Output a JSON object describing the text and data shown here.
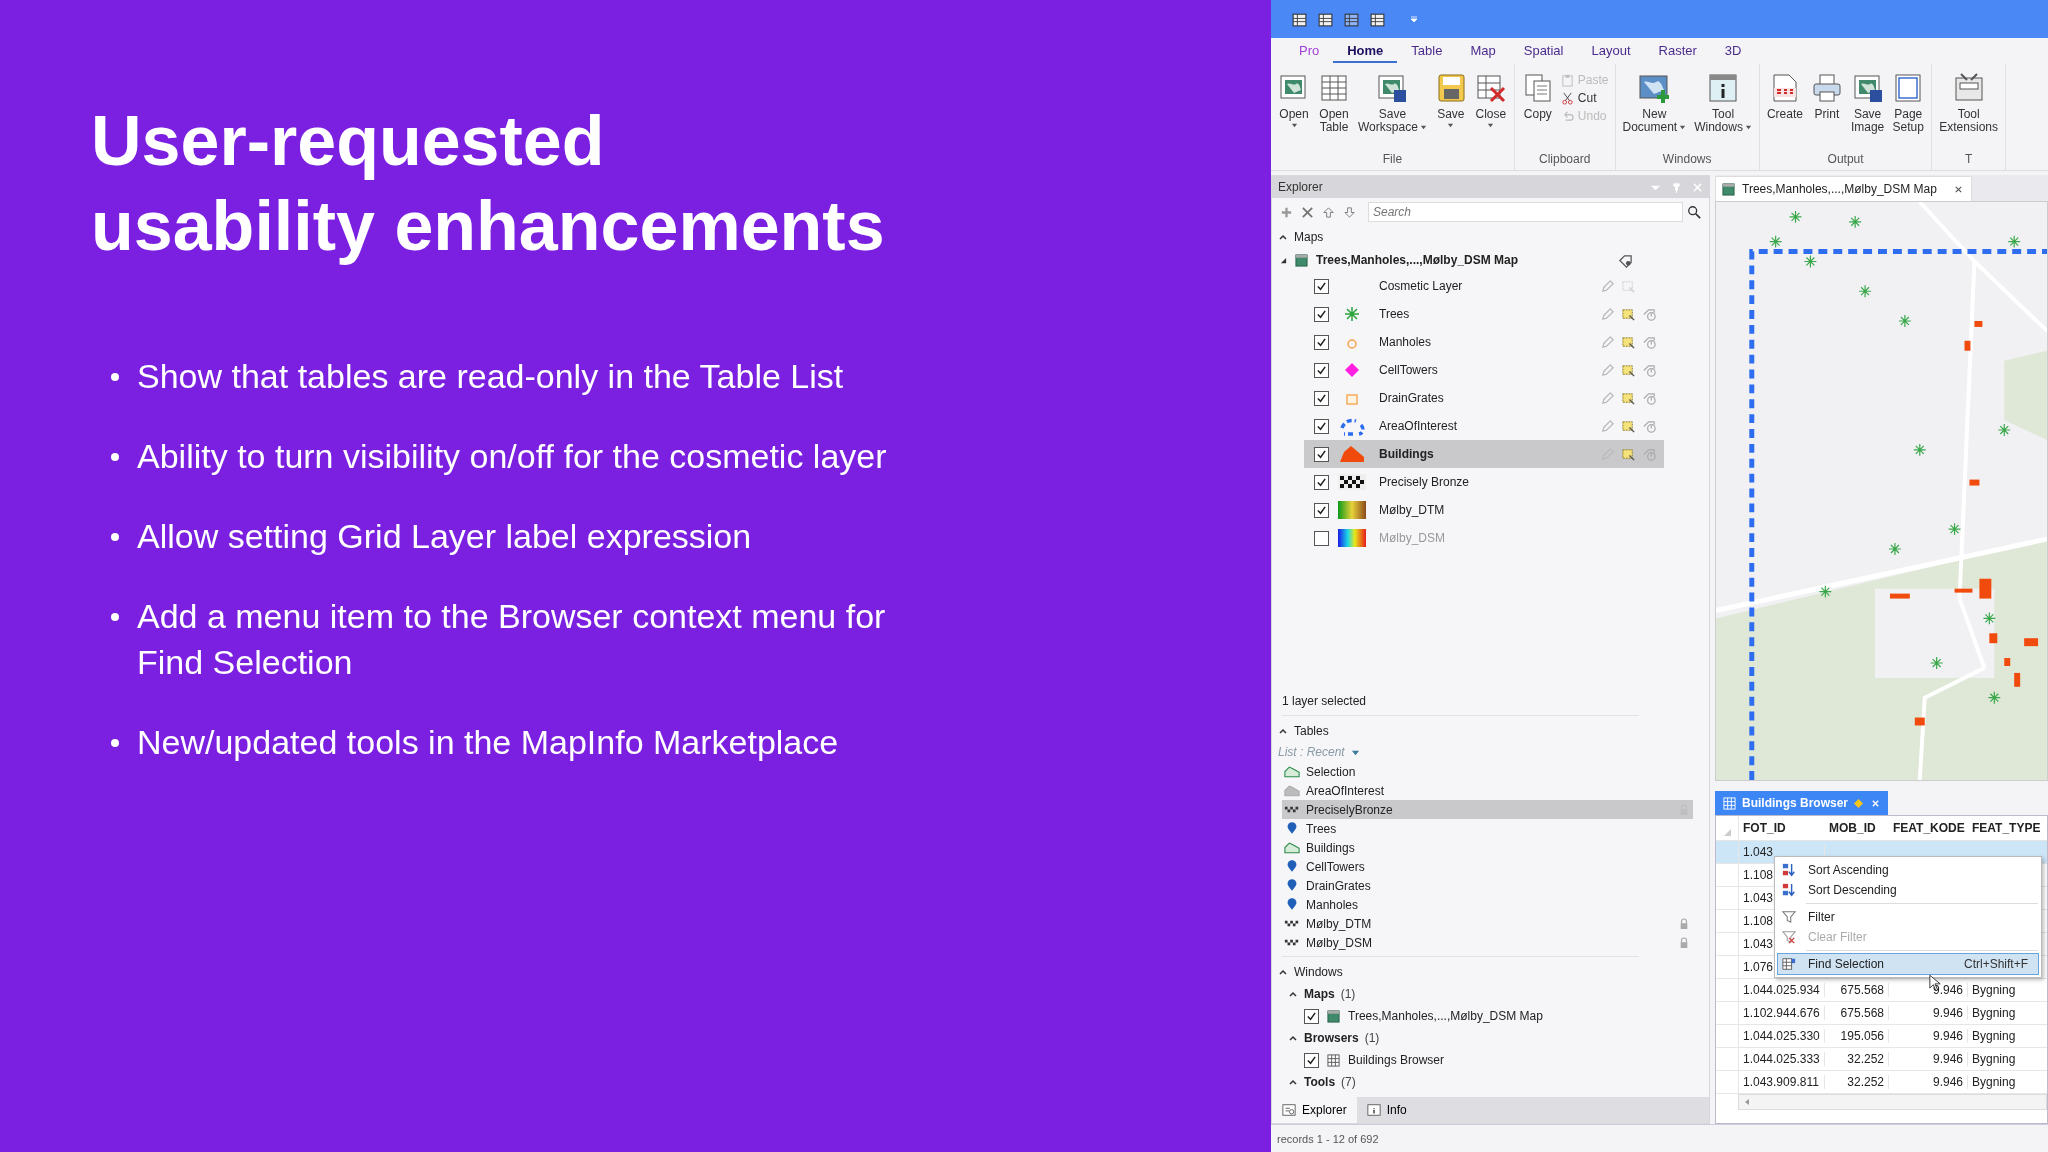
{
  "slide": {
    "title": "User-requested\nusability enhancements",
    "bullets": [
      "Show that tables are read-only in the Table List",
      "Ability to turn visibility on/off for the cosmetic layer",
      "Allow setting Grid Layer label expression",
      "Add a menu item to the Browser context menu for\nFind Selection",
      "New/updated tools in the MapInfo Marketplace"
    ]
  },
  "ribbon": {
    "tabs": [
      {
        "label": "Pro",
        "kind": "backstage",
        "selected": false
      },
      {
        "label": "Home",
        "kind": "tab",
        "selected": true
      },
      {
        "label": "Table",
        "kind": "tab",
        "selected": false
      },
      {
        "label": "Map",
        "kind": "tab",
        "selected": false
      },
      {
        "label": "Spatial",
        "kind": "tab",
        "selected": false
      },
      {
        "label": "Layout",
        "kind": "tab",
        "selected": false
      },
      {
        "label": "Raster",
        "kind": "tab",
        "selected": false
      },
      {
        "label": "3D",
        "kind": "tab",
        "selected": false
      }
    ],
    "groups": [
      {
        "label": "File",
        "buttons": [
          {
            "lines": [
              "Open"
            ],
            "dropdown": true
          },
          {
            "lines": [
              "Open",
              "Table"
            ],
            "dropdown": false
          },
          {
            "lines": [
              "Save",
              "Workspace"
            ],
            "dropdown": true
          },
          {
            "lines": [
              "Save"
            ],
            "dropdown": true
          },
          {
            "lines": [
              "Close"
            ],
            "dropdown": true
          }
        ]
      },
      {
        "label": "Clipboard",
        "buttons": [
          {
            "lines": [
              "Copy"
            ],
            "dropdown": false
          }
        ],
        "small": [
          {
            "label": "Paste",
            "disabled": true
          },
          {
            "label": "Cut",
            "disabled": false
          },
          {
            "label": "Undo",
            "disabled": true
          }
        ]
      },
      {
        "label": "Windows",
        "buttons": [
          {
            "lines": [
              "New",
              "Document"
            ],
            "dropdown": true
          },
          {
            "lines": [
              "Tool",
              "Windows"
            ],
            "dropdown": true
          }
        ]
      },
      {
        "label": "Output",
        "buttons": [
          {
            "lines": [
              "Create"
            ],
            "dropdown": false
          },
          {
            "lines": [
              "Print"
            ],
            "dropdown": false
          },
          {
            "lines": [
              "Save",
              "Image"
            ],
            "dropdown": false
          },
          {
            "lines": [
              "Page",
              "Setup"
            ],
            "dropdown": false
          }
        ]
      },
      {
        "label": "T",
        "buttons": [
          {
            "lines": [
              "Tool",
              "Extensions"
            ],
            "dropdown": false
          }
        ]
      }
    ]
  },
  "explorer": {
    "title": "Explorer",
    "search": {
      "placeholder": "Search"
    },
    "maps": {
      "label": "Maps",
      "expanded": true,
      "map": {
        "name": "Trees,Manholes,...,Mølby_DSM Map",
        "expanded": true
      },
      "layers": [
        {
          "name": "Cosmetic Layer",
          "kind": "cosmetic",
          "checked": true,
          "selected": false
        },
        {
          "name": "Trees",
          "kind": "star",
          "checked": true,
          "selected": false
        },
        {
          "name": "Manholes",
          "kind": "circle",
          "checked": true,
          "selected": false
        },
        {
          "name": "CellTowers",
          "kind": "diamond",
          "checked": true,
          "selected": false
        },
        {
          "name": "DrainGrates",
          "kind": "square",
          "checked": true,
          "selected": false
        },
        {
          "name": "AreaOfInterest",
          "kind": "dashed",
          "checked": true,
          "selected": false
        },
        {
          "name": "Buildings",
          "kind": "polygon",
          "checked": true,
          "selected": true
        },
        {
          "name": "Precisely Bronze",
          "kind": "checker",
          "checked": true,
          "selected": false
        },
        {
          "name": "Mølby_DTM",
          "kind": "terrain",
          "checked": true,
          "selected": false
        },
        {
          "name": "Mølby_DSM",
          "kind": "rainbow",
          "checked": false,
          "selected": false
        }
      ]
    },
    "status": "1 layer selected",
    "tables": {
      "label": "Tables",
      "expanded": true,
      "list": "List : Recent",
      "items": [
        {
          "name": "Selection",
          "kind": "region",
          "selected": false,
          "locked": false
        },
        {
          "name": "AreaOfInterest",
          "kind": "region-grey",
          "selected": false,
          "locked": false
        },
        {
          "name": "PreciselyBronze",
          "kind": "raster",
          "selected": true,
          "locked": true
        },
        {
          "name": "Trees",
          "kind": "point",
          "selected": false,
          "locked": false
        },
        {
          "name": "Buildings",
          "kind": "region",
          "selected": false,
          "locked": false
        },
        {
          "name": "CellTowers",
          "kind": "point",
          "selected": false,
          "locked": false
        },
        {
          "name": "DrainGrates",
          "kind": "point",
          "selected": false,
          "locked": false
        },
        {
          "name": "Manholes",
          "kind": "point",
          "selected": false,
          "locked": false
        },
        {
          "name": "Mølby_DTM",
          "kind": "raster",
          "selected": false,
          "locked": true
        },
        {
          "name": "Mølby_DSM",
          "kind": "raster",
          "selected": false,
          "locked": true
        }
      ]
    },
    "windows": {
      "label": "Windows",
      "expanded": true,
      "groups": [
        {
          "label": "Maps",
          "count": "(1)",
          "expanded": true,
          "items": [
            {
              "name": "Trees,Manholes,...,Mølby_DSM Map",
              "kind": "map",
              "checked": true
            }
          ]
        },
        {
          "label": "Browsers",
          "count": "(1)",
          "expanded": true,
          "items": [
            {
              "name": "Buildings Browser",
              "kind": "browser",
              "checked": true
            }
          ]
        },
        {
          "label": "Tools",
          "count": "(7)",
          "expanded": true
        }
      ]
    },
    "bottom_tabs": [
      {
        "label": "Explorer",
        "selected": true
      },
      {
        "label": "Info",
        "selected": false
      }
    ]
  },
  "map_window": {
    "title": "Trees,Manholes,...,Mølby_DSM Map"
  },
  "browser": {
    "title": "Buildings Browser",
    "modified": true,
    "columns": [
      "FOT_ID",
      "MOB_ID",
      "FEAT_KODE",
      "FEAT_TYPE"
    ],
    "rows": [
      {
        "cells": [
          "1.043"
        ],
        "selected": true
      },
      {
        "cells": [
          "1.108"
        ],
        "selected": false
      },
      {
        "cells": [
          "1.043"
        ],
        "selected": false
      },
      {
        "cells": [
          "1.108"
        ],
        "selected": false
      },
      {
        "cells": [
          "1.043"
        ],
        "selected": false
      },
      {
        "cells": [
          "1.076"
        ],
        "selected": false
      },
      {
        "cells": [
          "1.044.025.934",
          "675.568",
          "9.946",
          "Bygning"
        ],
        "selected": false
      },
      {
        "cells": [
          "1.102.944.676",
          "675.568",
          "9.946",
          "Bygning"
        ],
        "selected": false
      },
      {
        "cells": [
          "1.044.025.330",
          "195.056",
          "9.946",
          "Bygning"
        ],
        "selected": false
      },
      {
        "cells": [
          "1.044.025.333",
          "32.252",
          "9.946",
          "Bygning"
        ],
        "selected": false
      },
      {
        "cells": [
          "1.043.909.811",
          "32.252",
          "9.946",
          "Bygning"
        ],
        "selected": false
      }
    ],
    "menu": [
      {
        "label": "Sort Ascending",
        "kind": "sort-asc",
        "disabled": false,
        "selected": false
      },
      {
        "label": "Sort Descending",
        "kind": "sort-desc",
        "disabled": false,
        "selected": false
      },
      {
        "kind": "separator"
      },
      {
        "label": "Filter",
        "kind": "filter",
        "disabled": false,
        "selected": false
      },
      {
        "label": "Clear Filter",
        "kind": "clear-filter",
        "disabled": true,
        "selected": false
      },
      {
        "kind": "separator"
      },
      {
        "label": "Find Selection",
        "kind": "find",
        "shortcut": "Ctrl+Shift+F",
        "disabled": false,
        "selected": true
      }
    ]
  },
  "status_bar": "records 1 - 12 of 692"
}
